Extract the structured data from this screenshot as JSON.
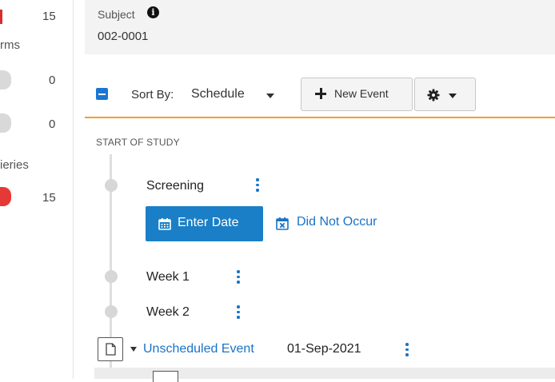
{
  "left_panel": {
    "top_count": "15",
    "forms_label": "rms",
    "forms_counts": [
      "0",
      "0"
    ],
    "queries_label": "ieries",
    "queries_count": "15"
  },
  "subject": {
    "label": "Subject",
    "id": "002-0001"
  },
  "toolbar": {
    "sort_label": "Sort By:",
    "sort_value": "Schedule",
    "new_event_label": "New Event"
  },
  "timeline": {
    "start_label": "START OF STUDY",
    "events": [
      {
        "name": "Screening"
      },
      {
        "name": "Week 1"
      },
      {
        "name": "Week 2"
      }
    ],
    "enter_date_label": "Enter Date",
    "did_not_occur_label": "Did Not Occur",
    "unscheduled": {
      "label": "Unscheduled Event",
      "date": "01-Sep-2021"
    }
  },
  "colors": {
    "accent_blue": "#1a7fc7",
    "link_blue": "#1a73c7",
    "orange_divider": "#f0a030",
    "alert_red": "#e53935"
  }
}
